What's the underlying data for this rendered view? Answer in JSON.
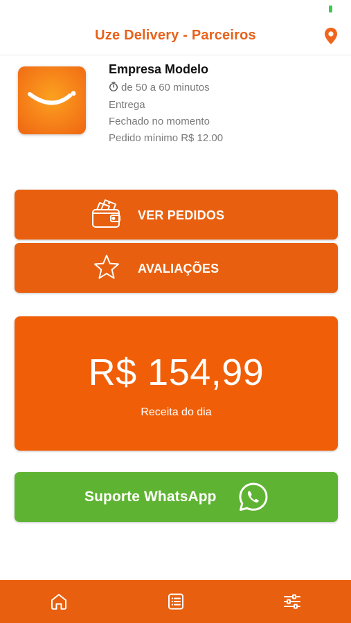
{
  "header": {
    "title": "Uze Delivery - Parceiros",
    "location_icon": "map-pin-icon"
  },
  "store": {
    "name": "Empresa Modelo",
    "delivery_time": "de 50 a 60 minutos",
    "delivery_type": "Entrega",
    "status": "Fechado no momento",
    "min_order": "Pedido mínimo R$ 12.00"
  },
  "actions": {
    "orders_label": "VER PEDIDOS",
    "orders_icon": "wallet-icon",
    "reviews_label": "AVALIAÇÕES",
    "reviews_icon": "star-icon"
  },
  "revenue": {
    "value": "R$ 154,99",
    "label": "Receita do dia"
  },
  "support": {
    "label": "Suporte WhatsApp",
    "icon": "whatsapp-icon"
  },
  "tabbar": {
    "items": [
      "home-icon",
      "list-icon",
      "settings-sliders-icon"
    ]
  },
  "colors": {
    "accent": "#e8600f",
    "revenue_bg": "#f05f08",
    "whatsapp_green": "#5fb332",
    "title_orange": "#e8621b"
  }
}
